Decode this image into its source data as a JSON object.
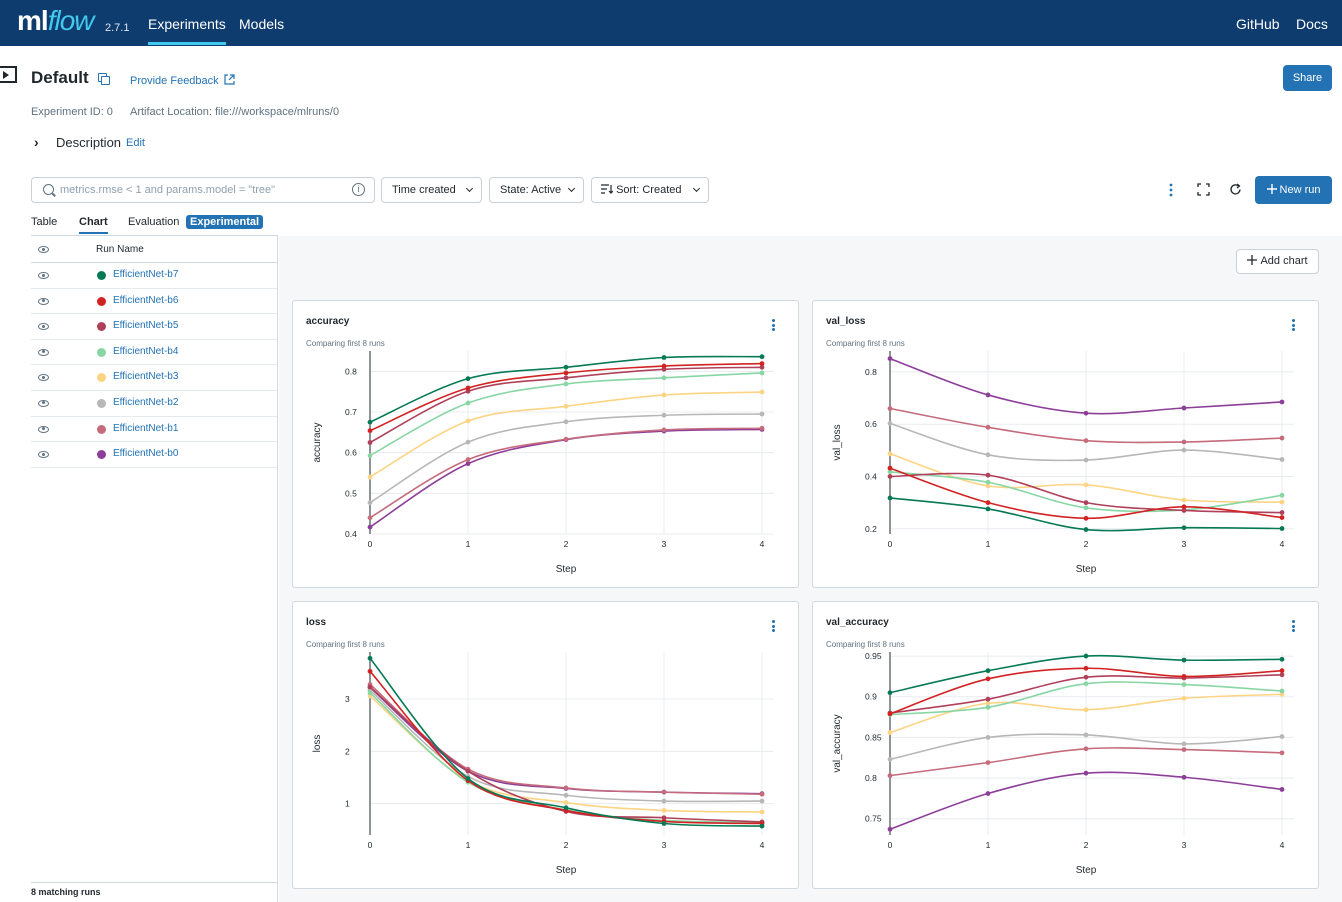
{
  "header": {
    "logo_main": "ml",
    "logo_flow": "flow",
    "version": "2.7.1",
    "nav": [
      "Experiments",
      "Models"
    ],
    "right_links": [
      "GitHub",
      "Docs"
    ]
  },
  "experiment": {
    "title": "Default",
    "feedback": "Provide Feedback",
    "share": "Share",
    "experiment_id": "Experiment ID: 0",
    "artifact_location": "Artifact Location: file:///workspace/mlruns/0",
    "description": "Description",
    "edit": "Edit"
  },
  "toolbar": {
    "search_placeholder": "metrics.rmse < 1 and params.model = \"tree\"",
    "time_created": "Time created",
    "state": "State: Active",
    "sort": "Sort: Created",
    "new_run": "New run"
  },
  "tabs": [
    "Table",
    "Chart",
    "Evaluation"
  ],
  "experimental_tag": "Experimental",
  "runs": {
    "header": "Run Name",
    "items": [
      {
        "name": "EfficientNet-b7",
        "color": "#077a55"
      },
      {
        "name": "EfficientNet-b6",
        "color": "#d22323"
      },
      {
        "name": "EfficientNet-b5",
        "color": "#b0405a"
      },
      {
        "name": "EfficientNet-b4",
        "color": "#88d6a3"
      },
      {
        "name": "EfficientNet-b3",
        "color": "#fcd483"
      },
      {
        "name": "EfficientNet-b2",
        "color": "#b7b7b7"
      },
      {
        "name": "EfficientNet-b1",
        "color": "#c56b7c"
      },
      {
        "name": "EfficientNet-b0",
        "color": "#8c3e99"
      }
    ],
    "footer": "8 matching runs"
  },
  "add_chart": "Add chart",
  "chart_data": [
    {
      "type": "line",
      "title": "accuracy",
      "subtitle": "Comparing first 8 runs",
      "xlabel": "Step",
      "ylabel": "accuracy",
      "x": [
        0,
        1,
        2,
        3,
        4
      ],
      "ylim": [
        0.4,
        0.85
      ],
      "yticks": [
        0.4,
        0.5,
        0.6,
        0.7,
        0.8
      ],
      "series": [
        {
          "name": "EfficientNet-b7",
          "values": [
            0.675,
            0.782,
            0.81,
            0.834,
            0.836
          ]
        },
        {
          "name": "EfficientNet-b6",
          "values": [
            0.654,
            0.759,
            0.796,
            0.813,
            0.819
          ]
        },
        {
          "name": "EfficientNet-b5",
          "values": [
            0.625,
            0.751,
            0.784,
            0.805,
            0.81
          ]
        },
        {
          "name": "EfficientNet-b4",
          "values": [
            0.593,
            0.722,
            0.769,
            0.784,
            0.796
          ]
        },
        {
          "name": "EfficientNet-b3",
          "values": [
            0.54,
            0.678,
            0.714,
            0.742,
            0.749
          ]
        },
        {
          "name": "EfficientNet-b2",
          "values": [
            0.477,
            0.626,
            0.676,
            0.692,
            0.695
          ]
        },
        {
          "name": "EfficientNet-b1",
          "values": [
            0.44,
            0.583,
            0.633,
            0.656,
            0.66
          ]
        },
        {
          "name": "EfficientNet-b0",
          "values": [
            0.417,
            0.573,
            0.632,
            0.653,
            0.657
          ]
        }
      ]
    },
    {
      "type": "line",
      "title": "val_loss",
      "subtitle": "Comparing first 8 runs",
      "xlabel": "Step",
      "ylabel": "val_loss",
      "x": [
        0,
        1,
        2,
        3,
        4
      ],
      "ylim": [
        0.18,
        0.88
      ],
      "yticks": [
        0.2,
        0.4,
        0.6,
        0.8
      ],
      "series": [
        {
          "name": "EfficientNet-b7",
          "values": [
            0.318,
            0.276,
            0.197,
            0.204,
            0.201
          ]
        },
        {
          "name": "EfficientNet-b6",
          "values": [
            0.432,
            0.3,
            0.24,
            0.284,
            0.243
          ]
        },
        {
          "name": "EfficientNet-b5",
          "values": [
            0.4,
            0.405,
            0.3,
            0.27,
            0.262
          ]
        },
        {
          "name": "EfficientNet-b4",
          "values": [
            0.418,
            0.378,
            0.28,
            0.272,
            0.328
          ]
        },
        {
          "name": "EfficientNet-b3",
          "values": [
            0.487,
            0.364,
            0.368,
            0.31,
            0.302
          ]
        },
        {
          "name": "EfficientNet-b2",
          "values": [
            0.603,
            0.483,
            0.463,
            0.501,
            0.465
          ]
        },
        {
          "name": "EfficientNet-b1",
          "values": [
            0.66,
            0.588,
            0.537,
            0.532,
            0.547
          ]
        },
        {
          "name": "EfficientNet-b0",
          "values": [
            0.851,
            0.712,
            0.642,
            0.662,
            0.685
          ]
        }
      ]
    },
    {
      "type": "line",
      "title": "loss",
      "subtitle": "Comparing first 8 runs",
      "xlabel": "Step",
      "ylabel": "loss",
      "x": [
        0,
        1,
        2,
        3,
        4
      ],
      "ylim": [
        0.4,
        3.9
      ],
      "yticks": [
        1,
        2,
        3
      ],
      "series": [
        {
          "name": "EfficientNet-b7",
          "values": [
            3.78,
            1.48,
            0.92,
            0.62,
            0.57
          ]
        },
        {
          "name": "EfficientNet-b6",
          "values": [
            3.53,
            1.44,
            0.87,
            0.66,
            0.62
          ]
        },
        {
          "name": "EfficientNet-b5",
          "values": [
            3.23,
            1.62,
            0.85,
            0.73,
            0.65
          ]
        },
        {
          "name": "EfficientNet-b4",
          "values": [
            3.12,
            1.41,
            0.88,
            0.68,
            0.64
          ]
        },
        {
          "name": "EfficientNet-b3",
          "values": [
            3.06,
            1.44,
            1.02,
            0.87,
            0.84
          ]
        },
        {
          "name": "EfficientNet-b2",
          "values": [
            3.17,
            1.52,
            1.16,
            1.05,
            1.05
          ]
        },
        {
          "name": "EfficientNet-b1",
          "values": [
            3.28,
            1.66,
            1.3,
            1.22,
            1.18
          ]
        },
        {
          "name": "EfficientNet-b0",
          "values": [
            3.22,
            1.62,
            1.29,
            1.22,
            1.19
          ]
        }
      ]
    },
    {
      "type": "line",
      "title": "val_accuracy",
      "subtitle": "Comparing first 8 runs",
      "xlabel": "Step",
      "ylabel": "val_accuracy",
      "x": [
        0,
        1,
        2,
        3,
        4
      ],
      "ylim": [
        0.73,
        0.955
      ],
      "yticks": [
        0.75,
        0.8,
        0.85,
        0.9,
        0.95
      ],
      "series": [
        {
          "name": "EfficientNet-b7",
          "values": [
            0.905,
            0.932,
            0.95,
            0.945,
            0.946
          ]
        },
        {
          "name": "EfficientNet-b6",
          "values": [
            0.879,
            0.922,
            0.935,
            0.925,
            0.932
          ]
        },
        {
          "name": "EfficientNet-b5",
          "values": [
            0.88,
            0.897,
            0.924,
            0.923,
            0.927
          ]
        },
        {
          "name": "EfficientNet-b4",
          "values": [
            0.878,
            0.887,
            0.916,
            0.915,
            0.907
          ]
        },
        {
          "name": "EfficientNet-b3",
          "values": [
            0.856,
            0.892,
            0.884,
            0.898,
            0.903
          ]
        },
        {
          "name": "EfficientNet-b2",
          "values": [
            0.823,
            0.85,
            0.853,
            0.842,
            0.851
          ]
        },
        {
          "name": "EfficientNet-b1",
          "values": [
            0.803,
            0.819,
            0.836,
            0.835,
            0.831
          ]
        },
        {
          "name": "EfficientNet-b0",
          "values": [
            0.737,
            0.781,
            0.806,
            0.801,
            0.786
          ]
        }
      ]
    }
  ]
}
